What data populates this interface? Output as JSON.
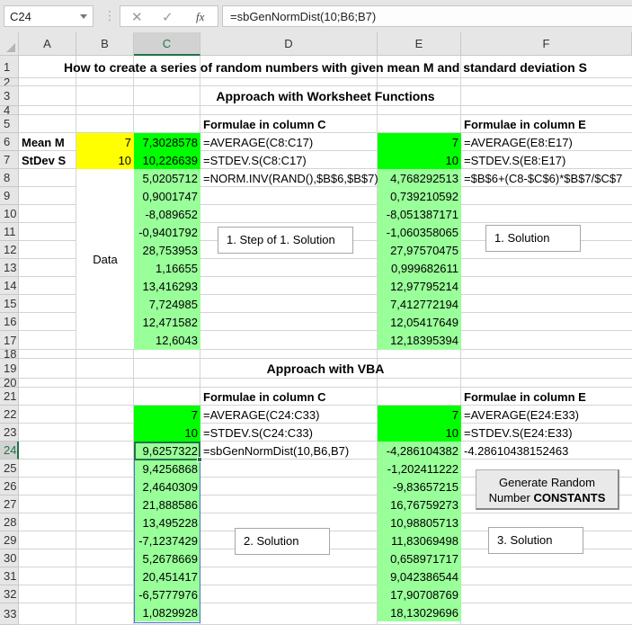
{
  "formula_bar": {
    "name_box": "C24",
    "cancel_icon": "✕",
    "enter_icon": "✓",
    "fx_label": "fx",
    "formula": "=sbGenNormDist(10;B6;B7)"
  },
  "columns": [
    "A",
    "B",
    "C",
    "D",
    "E",
    "F"
  ],
  "selected_column": "C",
  "rows": [
    "1",
    "2",
    "3",
    "4",
    "5",
    "6",
    "7",
    "8",
    "9",
    "10",
    "11",
    "12",
    "13",
    "14",
    "15",
    "16",
    "17",
    "18",
    "19",
    "20",
    "21",
    "22",
    "23",
    "24",
    "25",
    "26",
    "27",
    "28",
    "29",
    "30",
    "31",
    "32",
    "33"
  ],
  "selected_row": "24",
  "title": "How to create a series of random numbers with given mean M and standard deviation S",
  "section1": {
    "heading": "Approach with Worksheet Functions",
    "formulae_c_header": "Formulae in column C",
    "formulae_e_header": "Formulae in column E",
    "mean_label": "Mean M",
    "stdev_label": "StDev S",
    "mean_value": "7",
    "stdev_value": "10",
    "data_label": "Data",
    "c_mean": "7,3028578",
    "c_stdev": "10,226639",
    "c_formula_mean": "=AVERAGE(C8:C17)",
    "c_formula_stdev": "=STDEV.S(C8:C17)",
    "c_formula_data": "=NORM.INV(RAND(),$B$6,$B$7)",
    "e_mean": "7",
    "e_stdev": "10",
    "e_formula_mean": "=AVERAGE(E8:E17)",
    "e_formula_stdev": "=STDEV.S(E8:E17)",
    "e_formula_data": "=$B$6+(C8-$C$6)*$B$7/$C$7",
    "c_data": [
      "5,0205712",
      "0,9001747",
      "-8,089652",
      "-0,9401792",
      "28,753953",
      "1,16655",
      "13,416293",
      "7,724985",
      "12,471582",
      "12,6043"
    ],
    "e_data": [
      "4,768292513",
      "0,739210592",
      "-8,051387171",
      "-1,060358065",
      "27,97570475",
      "0,999682611",
      "12,97795214",
      "7,412772194",
      "12,05417649",
      "12,18395394"
    ],
    "textbox_step": "1. Step of 1. Solution",
    "textbox_solution": "1. Solution"
  },
  "section2": {
    "heading": "Approach with VBA",
    "formulae_c_header": "Formulae in column C",
    "formulae_e_header": "Formulae in column E",
    "c_mean": "7",
    "c_stdev": "10",
    "c_formula_mean": "=AVERAGE(C24:C33)",
    "c_formula_stdev": "=STDEV.S(C24:C33)",
    "c_formula_data": "=sbGenNormDist(10,B6,B7)",
    "e_mean": "7",
    "e_stdev": "10",
    "e_formula_mean": "=AVERAGE(E24:E33)",
    "e_formula_stdev": "=STDEV.S(E24:E33)",
    "e_constant": "-4.28610438152463",
    "c_data": [
      "9,6257322",
      "9,4256868",
      "2,4640309",
      "21,888586",
      "13,495228",
      "-7,1237429",
      "5,2678669",
      "20,451417",
      "-6,5777976",
      "1,0829928"
    ],
    "e_data": [
      "-4,286104382",
      "-1,202411222",
      "-9,83657215",
      "16,76759273",
      "10,98805713",
      "11,83069498",
      "0,658971717",
      "9,042386544",
      "17,90708769",
      "18,13029696"
    ],
    "button_line1": "Generate Random",
    "button_line2_normal": "Number ",
    "button_line2_bold": "CONSTANTS",
    "textbox_solution2": "2. Solution",
    "textbox_solution3": "3. Solution"
  },
  "colors": {
    "input_yellow": "#ffff00",
    "stat_green": "#00ff00",
    "data_lightgreen": "#99ff99",
    "excel_green": "#217346"
  }
}
